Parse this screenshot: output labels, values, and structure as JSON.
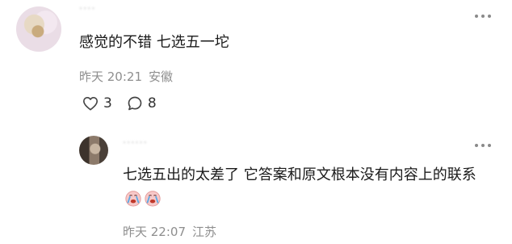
{
  "comments": [
    {
      "username": "····",
      "text": "感觉的不错 七选五一坨",
      "time": "昨天 20:21",
      "location": "安徽",
      "likes": "3",
      "replies": "8"
    },
    {
      "username": "······",
      "text": "七选五出的太差了 它答案和原文根本没有内容上的联系",
      "emojis": [
        "crying-face",
        "crying-face"
      ],
      "time": "昨天 22:07",
      "location": "江苏"
    }
  ],
  "icons": {
    "like": "heart-icon",
    "reply": "comment-bubble-icon",
    "more": "more-dots-icon"
  }
}
